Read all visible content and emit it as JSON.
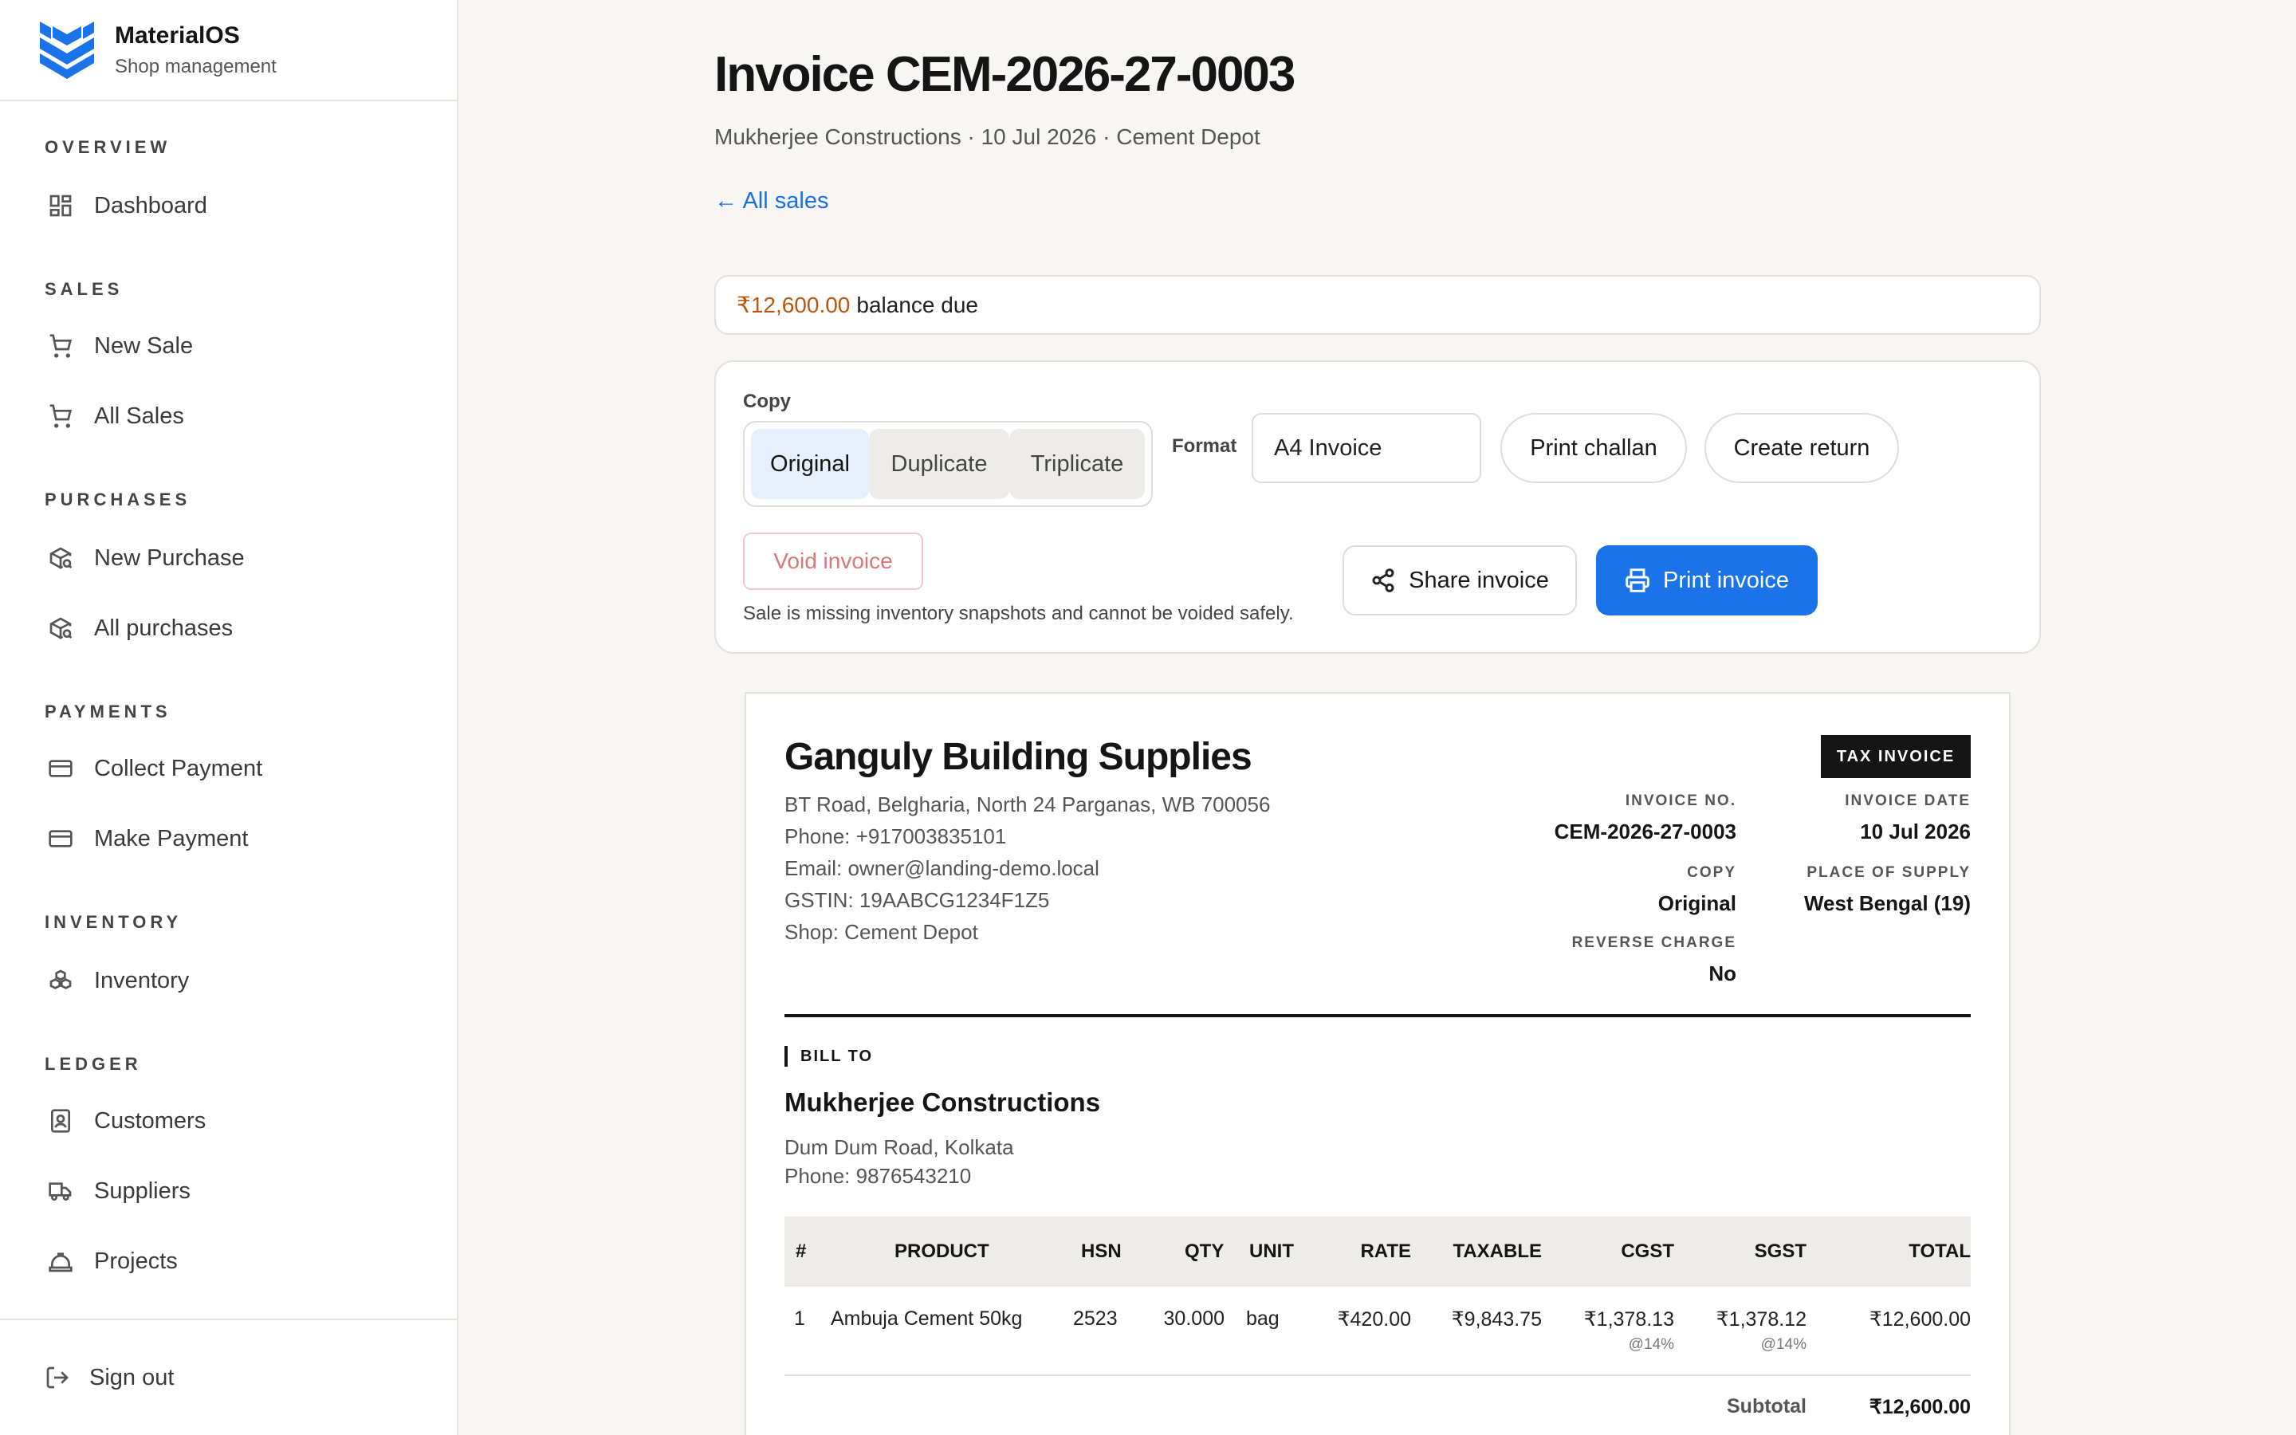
{
  "brand": {
    "name": "MaterialOS",
    "subtitle": "Shop management"
  },
  "sidebar": {
    "sections": [
      {
        "heading": "OVERVIEW",
        "items": [
          {
            "label": "Dashboard",
            "icon": "dashboard-icon"
          }
        ]
      },
      {
        "heading": "SALES",
        "items": [
          {
            "label": "New Sale",
            "icon": "cart-icon"
          },
          {
            "label": "All Sales",
            "icon": "cart-icon"
          }
        ]
      },
      {
        "heading": "PURCHASES",
        "items": [
          {
            "label": "New Purchase",
            "icon": "package-search-icon"
          },
          {
            "label": "All purchases",
            "icon": "package-search-icon"
          }
        ]
      },
      {
        "heading": "PAYMENTS",
        "items": [
          {
            "label": "Collect Payment",
            "icon": "credit-card-icon"
          },
          {
            "label": "Make Payment",
            "icon": "credit-card-icon"
          }
        ]
      },
      {
        "heading": "INVENTORY",
        "items": [
          {
            "label": "Inventory",
            "icon": "boxes-icon"
          }
        ]
      },
      {
        "heading": "LEDGER",
        "items": [
          {
            "label": "Customers",
            "icon": "contact-icon"
          },
          {
            "label": "Suppliers",
            "icon": "truck-icon"
          },
          {
            "label": "Projects",
            "icon": "hard-hat-icon"
          }
        ]
      }
    ],
    "sign_out": "Sign out"
  },
  "header": {
    "title": "Invoice CEM-2026-27-0003",
    "subtitle": "Mukherjee Constructions · 10 Jul 2026 · Cement Depot",
    "back_link": "← All sales"
  },
  "balance": {
    "amount": "₹12,600.00",
    "label": "balance due"
  },
  "actions": {
    "copy_label": "Copy",
    "copy_options": [
      "Original",
      "Duplicate",
      "Triplicate"
    ],
    "copy_selected": "Original",
    "format_label": "Format",
    "format_value": "A4 Invoice",
    "print_challan": "Print challan",
    "create_return": "Create return",
    "void_invoice": "Void invoice",
    "void_note": "Sale is missing inventory snapshots and cannot be voided safely.",
    "share_invoice": "Share invoice",
    "print_invoice": "Print invoice"
  },
  "invoice": {
    "shop_name": "Ganguly Building Supplies",
    "address": "BT Road, Belgharia, North 24 Parganas, WB 700056",
    "phone": "Phone: +917003835101",
    "email": "Email: owner@landing-demo.local",
    "gstin": "GSTIN: 19AABCG1234F1Z5",
    "shop": "Shop: Cement Depot",
    "badge": "TAX INVOICE",
    "meta": {
      "invoice_no_label": "INVOICE NO.",
      "invoice_no": "CEM-2026-27-0003",
      "invoice_date_label": "INVOICE DATE",
      "invoice_date": "10 Jul 2026",
      "copy_label": "COPY",
      "copy": "Original",
      "place_label": "PLACE OF SUPPLY",
      "place": "West Bengal (19)",
      "reverse_label": "REVERSE CHARGE",
      "reverse": "No"
    },
    "bill_to_label": "BILL TO",
    "customer_name": "Mukherjee Constructions",
    "customer_address": "Dum Dum Road, Kolkata",
    "customer_phone": "Phone: 9876543210",
    "columns": [
      "#",
      "PRODUCT",
      "HSN",
      "QTY",
      "UNIT",
      "RATE",
      "TAXABLE",
      "CGST",
      "SGST",
      "TOTAL"
    ],
    "rows": [
      {
        "no": "1",
        "product": "Ambuja Cement 50kg",
        "hsn": "2523",
        "qty": "30.000",
        "unit": "bag",
        "rate": "₹420.00",
        "taxable": "₹9,843.75",
        "cgst": "₹1,378.13",
        "cgst_rate": "@14%",
        "sgst": "₹1,378.12",
        "sgst_rate": "@14%",
        "total": "₹12,600.00"
      }
    ],
    "subtotal_label": "Subtotal",
    "subtotal": "₹12,600.00"
  }
}
